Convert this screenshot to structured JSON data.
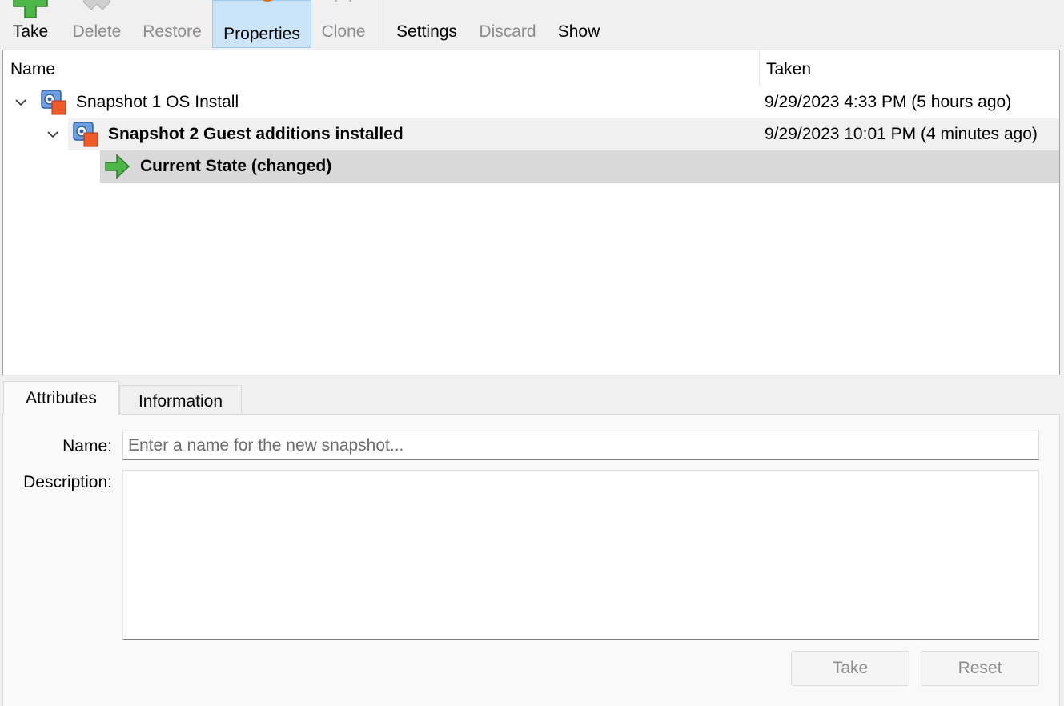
{
  "toolbar": {
    "buttons": [
      {
        "label": "Take",
        "icon": "plus-icon",
        "enabled": true
      },
      {
        "label": "Delete",
        "icon": "delete-x-icon",
        "enabled": false
      },
      {
        "label": "Restore",
        "icon": "restore-icon",
        "enabled": false
      },
      {
        "label": "Properties",
        "icon": "properties-gear-icon",
        "enabled": true,
        "active": true
      },
      {
        "label": "Clone",
        "icon": "clone-sheep-icon",
        "enabled": false
      },
      {
        "label": "Settings",
        "icon": "settings-gear-icon",
        "enabled": true
      },
      {
        "label": "Discard",
        "icon": "discard-arrow-icon",
        "enabled": false
      },
      {
        "label": "Show",
        "icon": "show-check-icon",
        "enabled": true
      }
    ]
  },
  "tree": {
    "columns": {
      "name": "Name",
      "taken": "Taken"
    },
    "rows": [
      {
        "label": "Snapshot 1 OS Install",
        "taken": "9/29/2023 4:33 PM (5 hours ago)",
        "icon": "snapshot-icon",
        "expanded": true
      },
      {
        "label": "Snapshot 2 Guest additions installed",
        "taken": "9/29/2023 10:01 PM (4 minutes ago)",
        "icon": "snapshot-icon",
        "expanded": true
      },
      {
        "label": "Current State (changed)",
        "taken": "",
        "icon": "current-state-arrow-icon",
        "selected": true
      }
    ]
  },
  "tabs": [
    {
      "label": "Attributes",
      "selected": true
    },
    {
      "label": "Information",
      "selected": false
    }
  ],
  "form": {
    "name_label": "Name:",
    "name_placeholder": "Enter a name for the new snapshot...",
    "name_value": "",
    "description_label": "Description:",
    "description_value": "",
    "take_label": "Take",
    "reset_label": "Reset"
  },
  "colors": {
    "active_button_bg": "#cce4f7",
    "selected_row_bg": "#d9d9d9",
    "hover_row_bg": "#f0f0f0",
    "disabled_text": "#8c8c8c",
    "accent_orange": "#f5a623",
    "accent_green": "#4cb648"
  }
}
